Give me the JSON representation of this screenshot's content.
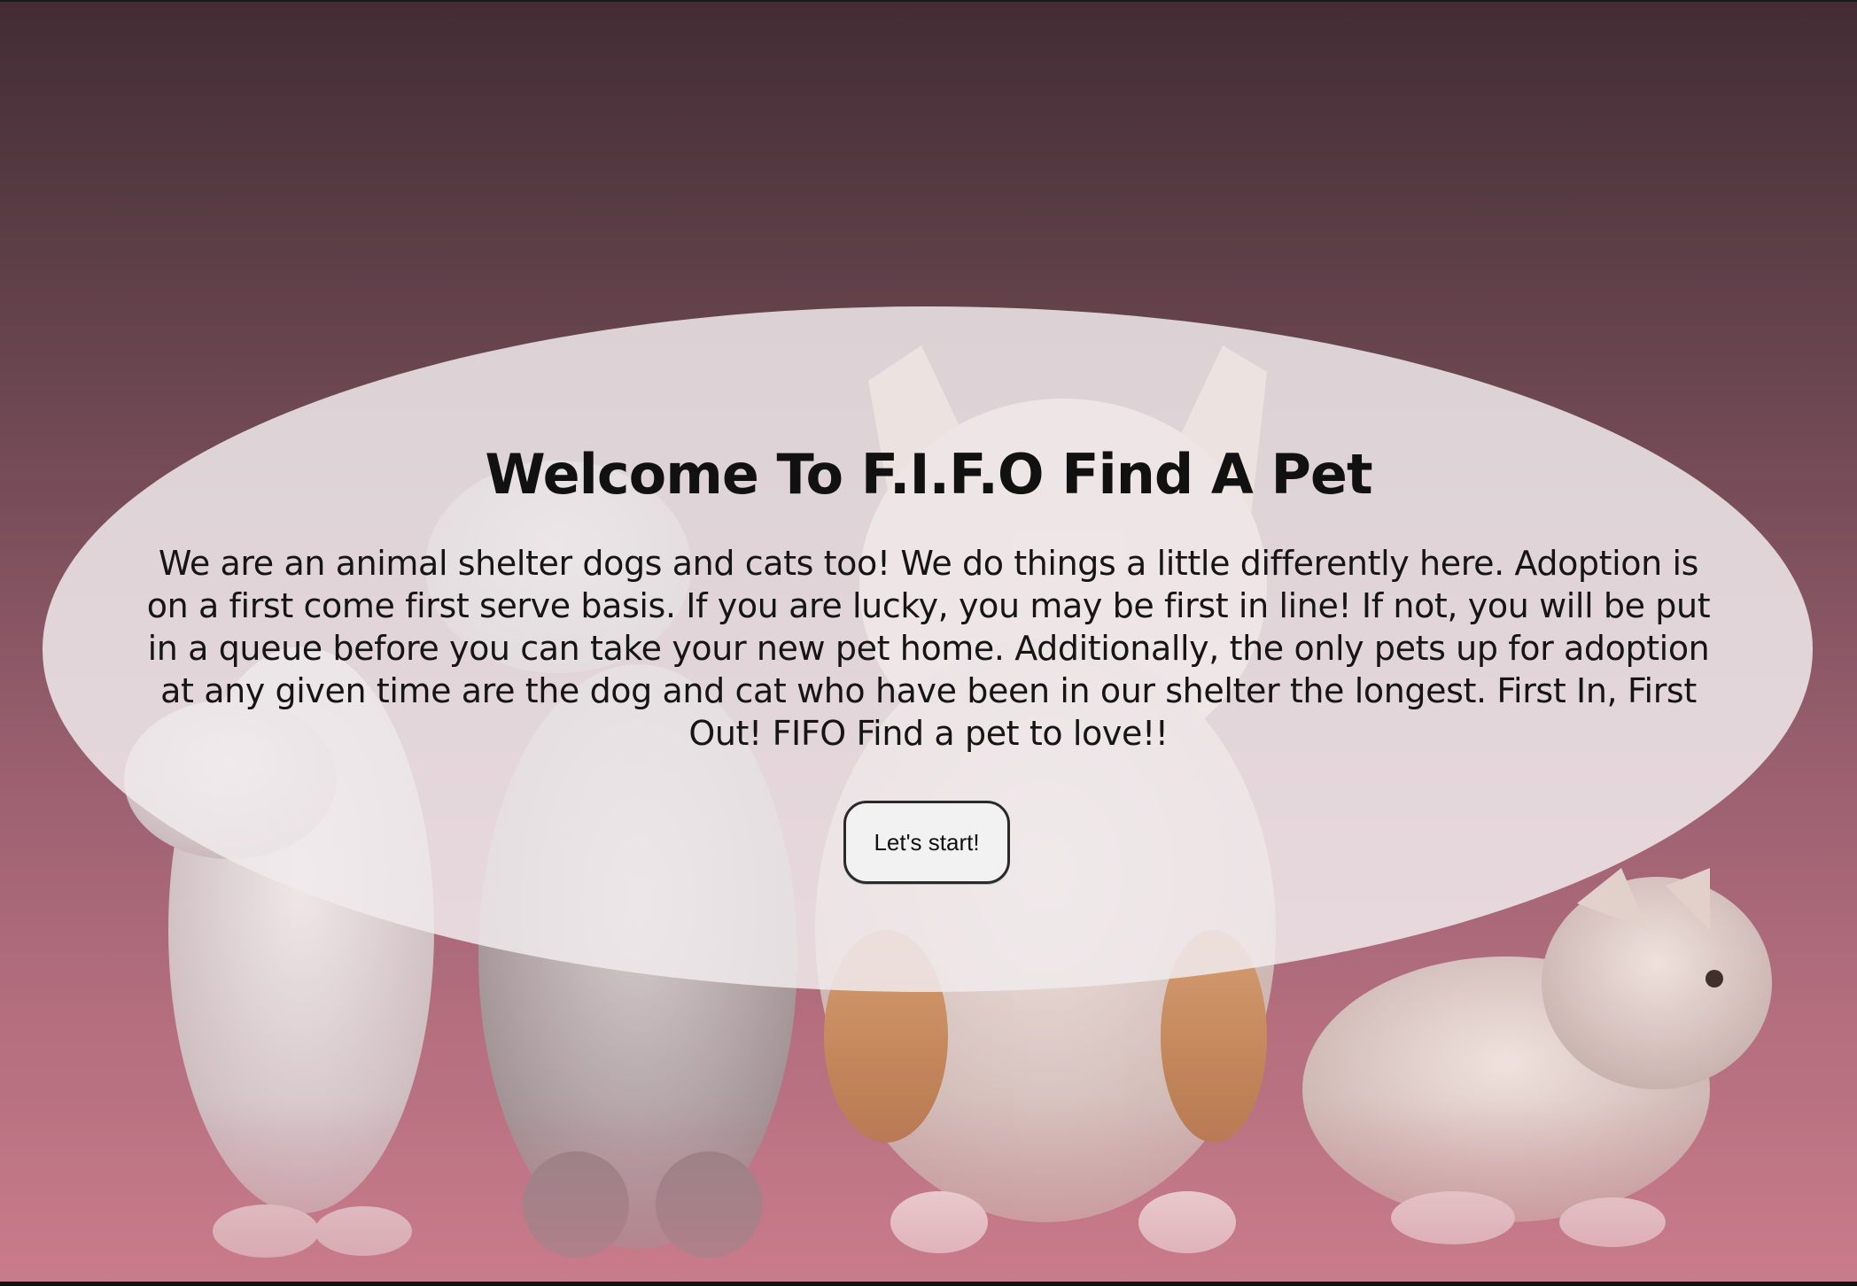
{
  "hero": {
    "title": "Welcome To F.I.F.O Find A Pet",
    "intro": "We are an animal shelter dogs and cats too! We do things a little differently here. Adoption is on a first come first serve basis. If you are lucky, you may be first in line! If not, you will be put in a queue before you can take your new pet home. Additionally, the only pets up for adoption at any given time are the dog and cat who have been in our shelter the longest. First In, First Out! FIFO Find a pet to love!!",
    "start_button_label": "Let's start!"
  },
  "background": {
    "description_colors": {
      "top": "#432c34",
      "bottom": "#c27886",
      "overlay": "#f0eaec"
    }
  }
}
